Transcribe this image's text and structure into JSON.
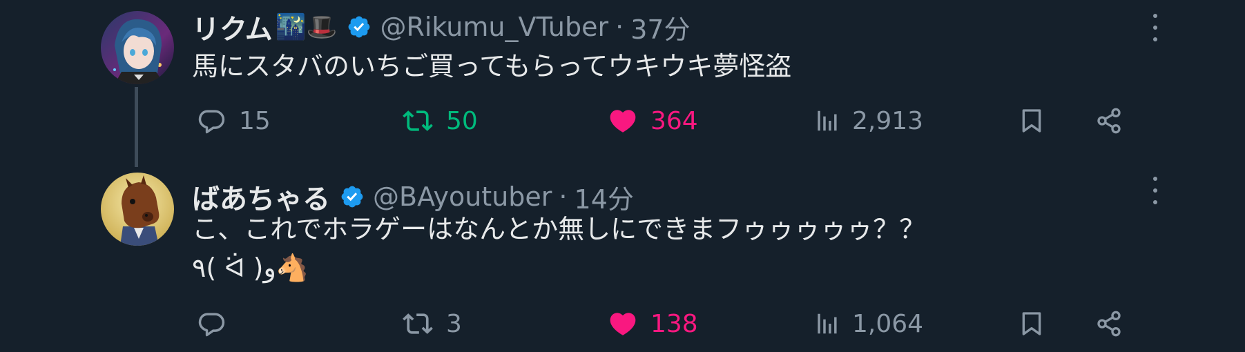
{
  "tweets": [
    {
      "display_name": "リクム",
      "name_emoji": "🌃🎩",
      "handle": "@Rikumu_VTuber",
      "separator": "·",
      "time": "37分",
      "text": "馬にスタバのいちご買ってもらってウキウキ夢怪盗",
      "replies": "15",
      "retweets": "50",
      "likes": "364",
      "views": "2,913"
    },
    {
      "display_name": "ばあちゃる",
      "handle": "@BAyoutuber",
      "separator": "·",
      "time": "14分",
      "text_line1": "こ、これでホラゲーはなんとか無しにできまフゥゥゥゥゥ？？",
      "text_line2": "٩( ᐛ )و🐴",
      "replies": "",
      "retweets": "3",
      "likes": "138",
      "views": "1,064"
    }
  ],
  "colors": {
    "background": "#15202b",
    "verified": "#1d9bf0",
    "retweet_active": "#00ba7c",
    "like_active": "#f91880",
    "muted": "#8b98a5"
  }
}
